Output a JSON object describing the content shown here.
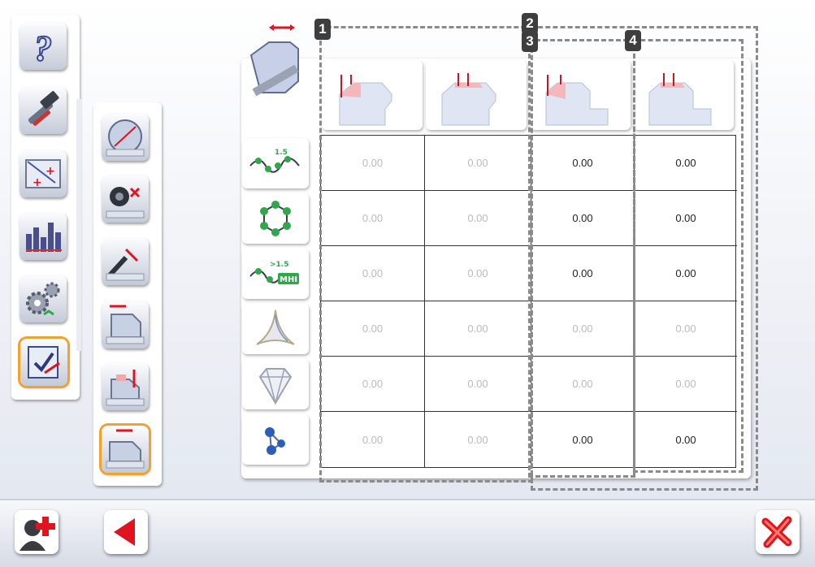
{
  "main_toolbar": {
    "items": [
      {
        "icon": "help-icon"
      },
      {
        "icon": "tools-icon"
      },
      {
        "icon": "points-icon"
      },
      {
        "icon": "statistics-icon"
      },
      {
        "icon": "settings-icon"
      },
      {
        "icon": "measurement-checklist-icon",
        "active": true
      }
    ]
  },
  "sub_toolbar": {
    "items": [
      {
        "icon": "diameter-measure-icon"
      },
      {
        "icon": "probe-measure-icon"
      },
      {
        "icon": "angle-measure-icon"
      },
      {
        "icon": "width-measure-icon"
      },
      {
        "icon": "height-measure-icon"
      },
      {
        "icon": "bevel-measure-icon",
        "active": true
      }
    ]
  },
  "table": {
    "group_badges": [
      "1",
      "2",
      "3",
      "4"
    ],
    "column_icons": [
      "bevel-left-low-icon",
      "bevel-left-high-icon",
      "step-bevel-low-icon",
      "step-bevel-high-icon"
    ],
    "row_icons": [
      "curve-1-5-icon",
      "polygon-icon",
      "curve-mhi-icon",
      "triangle-star-icon",
      "diamond-icon",
      "molecule-icon"
    ],
    "rows": [
      [
        "0.00",
        "0.00",
        "0.00",
        "0.00"
      ],
      [
        "0.00",
        "0.00",
        "0.00",
        "0.00"
      ],
      [
        "0.00",
        "0.00",
        "0.00",
        "0.00"
      ],
      [
        "0.00",
        "0.00",
        "0.00",
        "0.00"
      ],
      [
        "0.00",
        "0.00",
        "0.00",
        "0.00"
      ],
      [
        "0.00",
        "0.00",
        "0.00",
        "0.00"
      ]
    ],
    "enabled": [
      [
        false,
        false,
        true,
        true
      ],
      [
        false,
        false,
        true,
        true
      ],
      [
        false,
        false,
        true,
        true
      ],
      [
        false,
        false,
        false,
        false
      ],
      [
        false,
        false,
        false,
        false
      ],
      [
        false,
        false,
        true,
        true
      ]
    ]
  },
  "bottom_bar": {
    "icons": [
      "add-user-icon",
      "back-arrow-icon",
      "close-icon"
    ]
  },
  "colors": {
    "active_border": "#f0a22e",
    "accent_red": "#e0131f",
    "grid_line": "#333333",
    "disabled_text": "#bbbbbb"
  }
}
